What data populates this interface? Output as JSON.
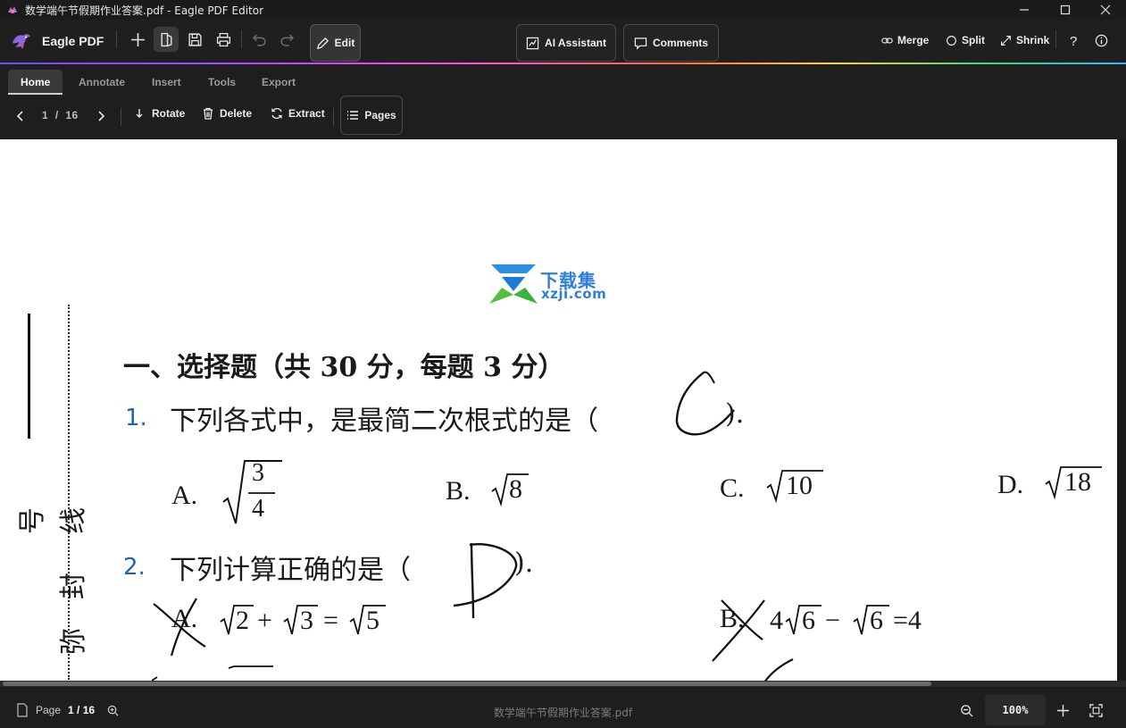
{
  "window": {
    "title": "数学端午节假期作业答案.pdf - Eagle PDF Editor",
    "controls": [
      "minimize",
      "maximize",
      "close"
    ]
  },
  "toolbar": {
    "brand": "Eagle PDF",
    "icons": [
      "plus-icon",
      "pages-panel-icon",
      "save-icon",
      "print-icon",
      "undo-icon",
      "redo-icon"
    ],
    "edit_label": "Edit",
    "ai_label": "AI Assistant",
    "comments_label": "Comments",
    "merge_label": "Merge",
    "split_label": "Split",
    "shrink_label": "Shrink",
    "help": "?",
    "accent_gradient": [
      "#6b4bff",
      "#b347ff",
      "#ff4fd8",
      "#ff6a3d",
      "#ffd23d",
      "#36d97b",
      "#2fb6ff"
    ]
  },
  "tabs": [
    {
      "label": "Home",
      "active": true
    },
    {
      "label": "Annotate",
      "active": false
    },
    {
      "label": "Insert",
      "active": false
    },
    {
      "label": "Tools",
      "active": false
    },
    {
      "label": "Export",
      "active": false
    }
  ],
  "ribbon": {
    "current_page": "1",
    "page_sep": "/",
    "total_pages": "16",
    "rotate_label": "Rotate",
    "delete_label": "Delete",
    "extract_label": "Extract",
    "pages_label": "Pages"
  },
  "document": {
    "watermark_zh": "下载集",
    "watermark_en": "xzji.com",
    "heading": "一、选择题（共 30 分，每题 3 分）",
    "q1": {
      "number": "1.",
      "text": "下列各式中，是最简二次根式的是（",
      "close": ").",
      "answer_mark": "C",
      "options": {
        "a_label": "A.",
        "a_num": "3",
        "a_den": "4",
        "b_label": "B.",
        "b_rad": "8",
        "c_label": "C.",
        "c_rad": "10",
        "d_label": "D.",
        "d_rad": "18"
      }
    },
    "q2": {
      "number": "2.",
      "text": "下列计算正确的是（",
      "close": ").",
      "answer_mark": "D",
      "options": {
        "a_label": "A.",
        "a_expr_parts": [
          "2",
          "+",
          "3",
          "=",
          "5"
        ],
        "b_label": "B.",
        "b_expr_parts": [
          "4",
          "6",
          "−",
          "6",
          "=4"
        ]
      }
    },
    "margin_chars": [
      "号",
      "线",
      "封",
      "弥"
    ],
    "question_number_color": "#1f63b5"
  },
  "status": {
    "page_label": "Page",
    "page_value": "1 / 16",
    "filename": "数学端午节假期作业答案.pdf",
    "zoom": "100%"
  }
}
